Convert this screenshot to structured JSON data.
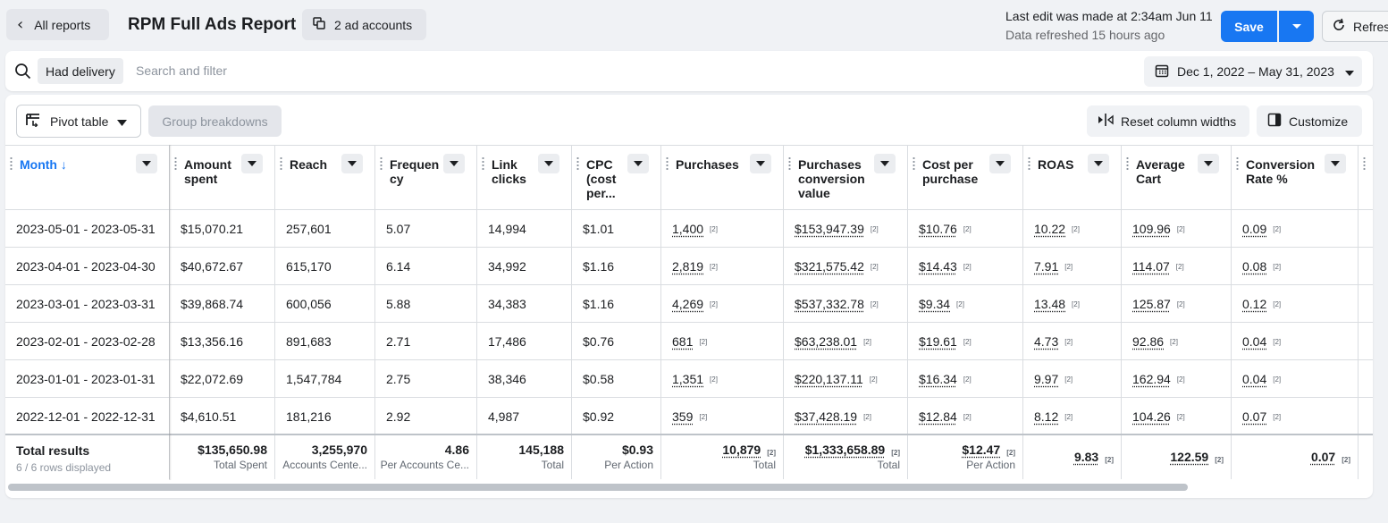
{
  "header": {
    "back_label": "All reports",
    "title": "RPM Full Ads Report",
    "ad_accounts_label": "2 ad accounts",
    "last_edit": "Last edit was made at 2:34am Jun 11",
    "data_refreshed": "Data refreshed 15 hours ago",
    "save_label": "Save",
    "refresh_label": "Refresh"
  },
  "filter": {
    "chip_label": "Had delivery",
    "search_placeholder": "Search and filter",
    "date_range": "Dec 1, 2022 – May 31, 2023"
  },
  "toolbar": {
    "pivot_label": "Pivot table",
    "group_label": "Group breakdowns",
    "reset_label": "Reset column widths",
    "customize_label": "Customize"
  },
  "columns": [
    {
      "lines": [
        "Month ↓"
      ]
    },
    {
      "lines": [
        "Amount",
        "spent"
      ]
    },
    {
      "lines": [
        "Reach"
      ]
    },
    {
      "lines": [
        "Frequen",
        "cy"
      ]
    },
    {
      "lines": [
        "Link",
        "clicks"
      ]
    },
    {
      "lines": [
        "CPC",
        "(cost",
        "per..."
      ]
    },
    {
      "lines": [
        "Purchases"
      ]
    },
    {
      "lines": [
        "Purchases",
        "conversion",
        "value"
      ]
    },
    {
      "lines": [
        "Cost per",
        "purchase"
      ]
    },
    {
      "lines": [
        "ROAS"
      ]
    },
    {
      "lines": [
        "Average",
        "Cart"
      ]
    },
    {
      "lines": [
        "Conversion",
        "Rate %"
      ]
    }
  ],
  "rows": [
    {
      "month": "2023-05-01 - 2023-05-31",
      "amount": "$15,070.21",
      "reach": "257,601",
      "frequency": "5.07",
      "clicks": "14,994",
      "cpc": "$1.01",
      "purchases": "1,400",
      "conv_value": "$153,947.39",
      "cost_per": "$10.76",
      "roas": "10.22",
      "avg_cart": "109.96",
      "conv_rate": "0.09"
    },
    {
      "month": "2023-04-01 - 2023-04-30",
      "amount": "$40,672.67",
      "reach": "615,170",
      "frequency": "6.14",
      "clicks": "34,992",
      "cpc": "$1.16",
      "purchases": "2,819",
      "conv_value": "$321,575.42",
      "cost_per": "$14.43",
      "roas": "7.91",
      "avg_cart": "114.07",
      "conv_rate": "0.08"
    },
    {
      "month": "2023-03-01 - 2023-03-31",
      "amount": "$39,868.74",
      "reach": "600,056",
      "frequency": "5.88",
      "clicks": "34,383",
      "cpc": "$1.16",
      "purchases": "4,269",
      "conv_value": "$537,332.78",
      "cost_per": "$9.34",
      "roas": "13.48",
      "avg_cart": "125.87",
      "conv_rate": "0.12"
    },
    {
      "month": "2023-02-01 - 2023-02-28",
      "amount": "$13,356.16",
      "reach": "891,683",
      "frequency": "2.71",
      "clicks": "17,486",
      "cpc": "$0.76",
      "purchases": "681",
      "conv_value": "$63,238.01",
      "cost_per": "$19.61",
      "roas": "4.73",
      "avg_cart": "92.86",
      "conv_rate": "0.04"
    },
    {
      "month": "2023-01-01 - 2023-01-31",
      "amount": "$22,072.69",
      "reach": "1,547,784",
      "frequency": "2.75",
      "clicks": "38,346",
      "cpc": "$0.58",
      "purchases": "1,351",
      "conv_value": "$220,137.11",
      "cost_per": "$16.34",
      "roas": "9.97",
      "avg_cart": "162.94",
      "conv_rate": "0.04"
    },
    {
      "month": "2022-12-01 - 2022-12-31",
      "amount": "$4,610.51",
      "reach": "181,216",
      "frequency": "2.92",
      "clicks": "4,987",
      "cpc": "$0.92",
      "purchases": "359",
      "conv_value": "$37,428.19",
      "cost_per": "$12.84",
      "roas": "8.12",
      "avg_cart": "104.26",
      "conv_rate": "0.07"
    }
  ],
  "superscript": "[2]",
  "totals": {
    "label": "Total results",
    "rows_displayed": "6 / 6 rows displayed",
    "amount": {
      "value": "$135,650.98",
      "sub": "Total Spent"
    },
    "reach": {
      "value": "3,255,970",
      "sub": "Accounts Cente..."
    },
    "frequency": {
      "value": "4.86",
      "sub": "Per Accounts Ce..."
    },
    "clicks": {
      "value": "145,188",
      "sub": "Total"
    },
    "cpc": {
      "value": "$0.93",
      "sub": "Per Action"
    },
    "purchases": {
      "value": "10,879",
      "sub": "Total"
    },
    "conv_value": {
      "value": "$1,333,658.89",
      "sub": "Total"
    },
    "cost_per": {
      "value": "$12.47",
      "sub": "Per Action"
    },
    "roas": {
      "value": "9.83"
    },
    "avg_cart": {
      "value": "122.59"
    },
    "conv_rate": {
      "value": "0.07"
    }
  },
  "colors": {
    "primary": "#1877f2",
    "border": "#dadde1",
    "muted": "#65676b"
  }
}
